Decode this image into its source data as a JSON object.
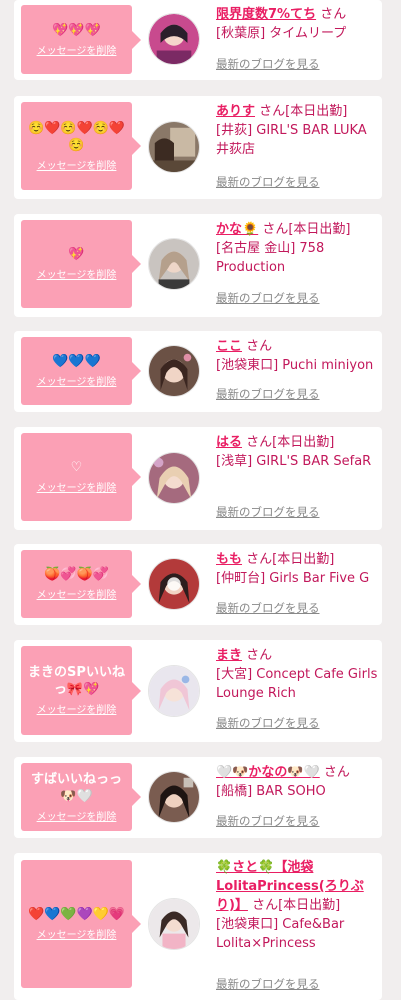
{
  "common": {
    "delete_label": "メッセージを削除",
    "blog_label": "最新のブログを見る"
  },
  "colors": {
    "page_bg": "#f1eeee",
    "bubble": "#fba0b5",
    "name_link": "#e91e63",
    "text": "#c2185b",
    "muted_link": "#888888"
  },
  "items": [
    {
      "message": "💖💖💖",
      "name": "限界度数7%てち",
      "honorific": "さん",
      "status": "",
      "shop": "[秋葉原] タイムリープ"
    },
    {
      "message": "☺️❤️☺️❤️☺️❤️☺️",
      "name": "ありす",
      "honorific": "さん",
      "status": "[本日出勤]",
      "shop": "[井荻] GIRL'S BAR LUKA　井荻店"
    },
    {
      "message": "💖",
      "name": "かな🌻",
      "honorific": "さん",
      "status": "[本日出勤]",
      "shop": "[名古屋 金山] 758 Production"
    },
    {
      "message": "💙💙💙",
      "name": "ここ",
      "honorific": "さん",
      "status": "",
      "shop": "[池袋東口] Puchi miniyon"
    },
    {
      "message": "♡",
      "name": "はる",
      "honorific": "さん",
      "status": "[本日出勤]",
      "shop": "[浅草] GIRL'S BAR SefaR"
    },
    {
      "message": "🍑💞🍑💞",
      "name": "もも",
      "honorific": "さん",
      "status": "[本日出勤]",
      "shop": "[仲町台] Girls Bar Five G"
    },
    {
      "message": "まきのSPいいねっ🎀💖",
      "name": "まき",
      "honorific": "さん",
      "status": "",
      "shop": "[大宮] Concept Cafe Girls Lounge Rich"
    },
    {
      "message": "すばいいねっっ🐶🤍",
      "name": "🤍🐶かなの🐶🤍",
      "honorific": "さん",
      "status": "",
      "shop": "[船橋] BAR SOHO"
    },
    {
      "message": "❤️💙💚💜💛💗",
      "name": "🍀さと🍀【池袋LolitaPrincess(ろりぷり)】",
      "honorific": "さん",
      "status": "[本日出勤]",
      "shop": "[池袋東口] Cafe&Bar Lolita×Princess"
    }
  ]
}
